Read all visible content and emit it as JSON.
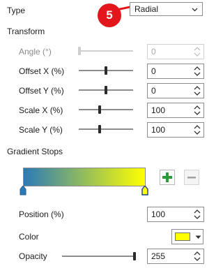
{
  "type_row": {
    "label": "Type",
    "value": "Radial"
  },
  "callout": {
    "number": "5",
    "color": "#e3171b"
  },
  "transform": {
    "heading": "Transform",
    "angle": {
      "label": "Angle (°)",
      "value": "0",
      "enabled": false,
      "slider_fraction": 0
    },
    "offset_x": {
      "label": "Offset X (%)",
      "value": "0",
      "slider_fraction": 0.5
    },
    "offset_y": {
      "label": "Offset Y (%)",
      "value": "0",
      "slider_fraction": 0.5
    },
    "scale_x": {
      "label": "Scale X (%)",
      "value": "100",
      "slider_fraction": 0.4
    },
    "scale_y": {
      "label": "Scale Y (%)",
      "value": "100",
      "slider_fraction": 0.4
    }
  },
  "gradient_stops": {
    "heading": "Gradient Stops",
    "colors": {
      "start": "#2a7ab8",
      "end": "#ffff00"
    },
    "add_icon": "plus-icon",
    "remove_icon": "minus-icon",
    "position": {
      "label": "Position (%)",
      "value": "100"
    },
    "color": {
      "label": "Color",
      "swatch": "#ffff00"
    },
    "opacity": {
      "label": "Opacity",
      "value": "255",
      "slider_fraction": 1.0
    }
  }
}
